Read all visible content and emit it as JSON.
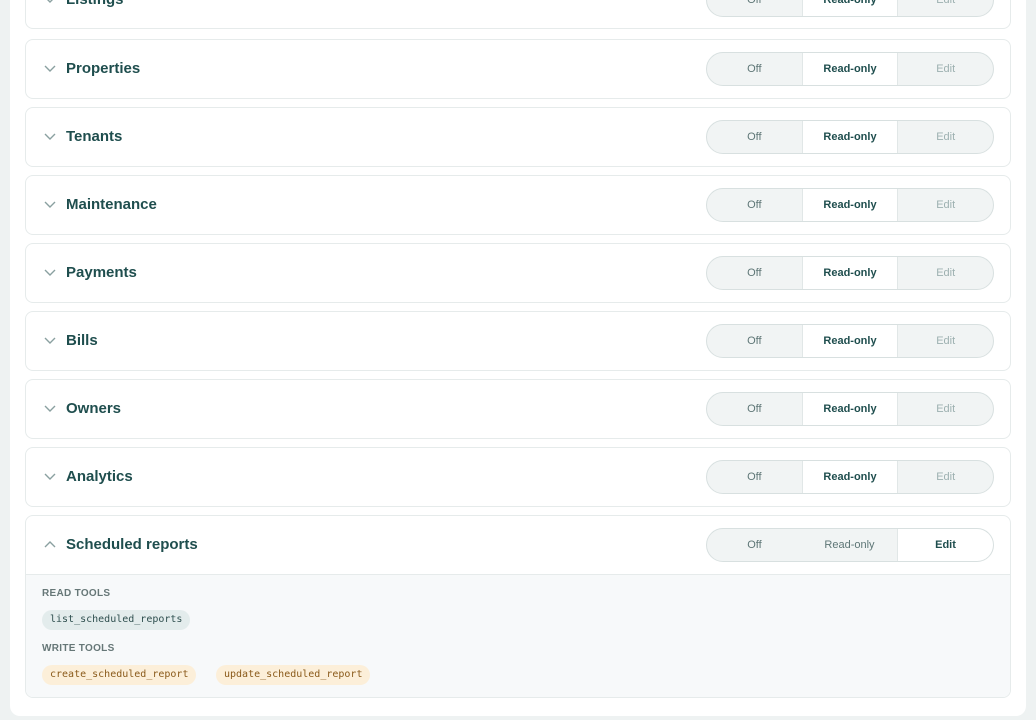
{
  "segment_labels": {
    "off": "Off",
    "read_only": "Read-only",
    "edit": "Edit"
  },
  "sections": [
    {
      "title": "Listings",
      "mode": "read-only",
      "expanded": false
    },
    {
      "title": "Properties",
      "mode": "read-only",
      "expanded": false
    },
    {
      "title": "Tenants",
      "mode": "read-only",
      "expanded": false
    },
    {
      "title": "Maintenance",
      "mode": "read-only",
      "expanded": false
    },
    {
      "title": "Payments",
      "mode": "read-only",
      "expanded": false
    },
    {
      "title": "Bills",
      "mode": "read-only",
      "expanded": false
    },
    {
      "title": "Owners",
      "mode": "read-only",
      "expanded": false
    },
    {
      "title": "Analytics",
      "mode": "read-only",
      "expanded": false
    },
    {
      "title": "Scheduled reports",
      "mode": "edit",
      "expanded": true
    }
  ],
  "expanded_details": {
    "read_tools_label": "READ TOOLS",
    "read_tools": [
      "list_scheduled_reports"
    ],
    "write_tools_label": "WRITE TOOLS",
    "write_tools": [
      "create_scheduled_report",
      "update_scheduled_report"
    ]
  },
  "colors": {
    "title": "#1f4e4e",
    "read_chip_bg": "#e3ecec",
    "write_chip_bg": "#fcefd9"
  },
  "icons": {
    "collapsed": "chevron-down-icon",
    "expanded": "chevron-up-icon"
  }
}
